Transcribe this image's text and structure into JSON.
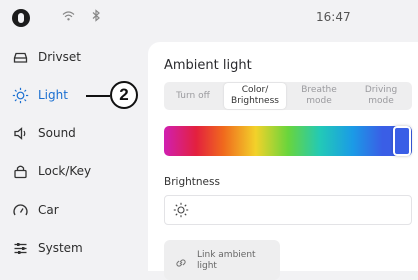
{
  "status_bar": {
    "time": "16:47",
    "icons": [
      "logo-icon",
      "wifi-icon",
      "bluetooth-icon"
    ]
  },
  "sidebar": {
    "items": [
      {
        "label": "Drivset",
        "icon": "car-front-icon",
        "active": false
      },
      {
        "label": "Light",
        "icon": "sun-icon",
        "active": true
      },
      {
        "label": "Sound",
        "icon": "speaker-icon",
        "active": false
      },
      {
        "label": "Lock/Key",
        "icon": "lock-icon",
        "active": false
      },
      {
        "label": "Car",
        "icon": "gauge-icon",
        "active": false
      },
      {
        "label": "System",
        "icon": "sliders-icon",
        "active": false
      }
    ]
  },
  "callout": {
    "number": "2"
  },
  "panel": {
    "title": "Ambient light",
    "modes": [
      {
        "label": "Turn off",
        "selected": false
      },
      {
        "label": "Color/\nBrightness",
        "selected": true
      },
      {
        "label": "Breathe\nmode",
        "selected": false
      },
      {
        "label": "Driving\nmode",
        "selected": false
      }
    ],
    "color_slider": {
      "position": 0.95
    },
    "brightness_label": "Brightness",
    "link_button": {
      "label": "Link ambient\nlight"
    }
  },
  "colors": {
    "accent": "#1a6fd1",
    "panel_bg": "#ffffff",
    "page_bg": "#f2f2f4"
  }
}
